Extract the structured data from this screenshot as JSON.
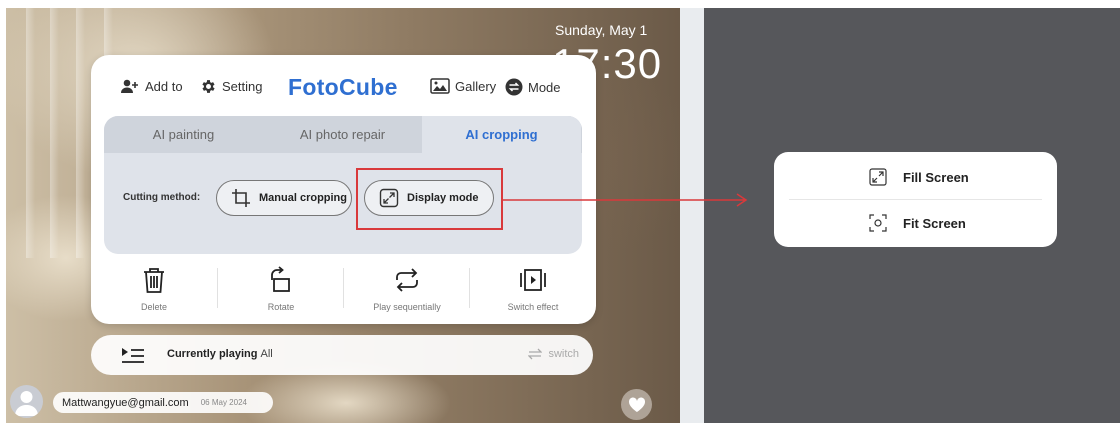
{
  "lockscreen": {
    "date": "Sunday, May 1",
    "time": "17:30"
  },
  "toolbar": {
    "add_label": "Add to",
    "setting_label": "Setting",
    "brand": "FotoCube",
    "gallery_label": "Gallery",
    "mode_label": "Mode"
  },
  "ai_tabs": [
    {
      "label": "AI painting"
    },
    {
      "label": "AI photo repair"
    },
    {
      "label": "AI cropping",
      "active": true
    }
  ],
  "cropping": {
    "method_label": "Cutting method:",
    "manual_label": "Manual cropping",
    "display_label": "Display mode"
  },
  "actions": [
    {
      "label": "Delete",
      "icon": "trash-icon"
    },
    {
      "label": "Rotate",
      "icon": "rotate-icon"
    },
    {
      "label": "Play sequentially",
      "icon": "loop-icon"
    },
    {
      "label": "Switch effect",
      "icon": "switch-effect-icon"
    }
  ],
  "playbar": {
    "title": "Currently playing",
    "value": "All",
    "switch_label": "switch"
  },
  "user": {
    "email": "Mattwangyue@gmail.com",
    "date": "06 May 2024"
  },
  "display_menu": {
    "items": [
      {
        "label": "Fill Screen",
        "icon": "fill-screen-icon"
      },
      {
        "label": "Fit Screen",
        "icon": "fit-screen-icon"
      }
    ]
  },
  "colors": {
    "brand": "#2f6fd1",
    "highlight": "#d9393b",
    "right_background": "#56575b"
  }
}
